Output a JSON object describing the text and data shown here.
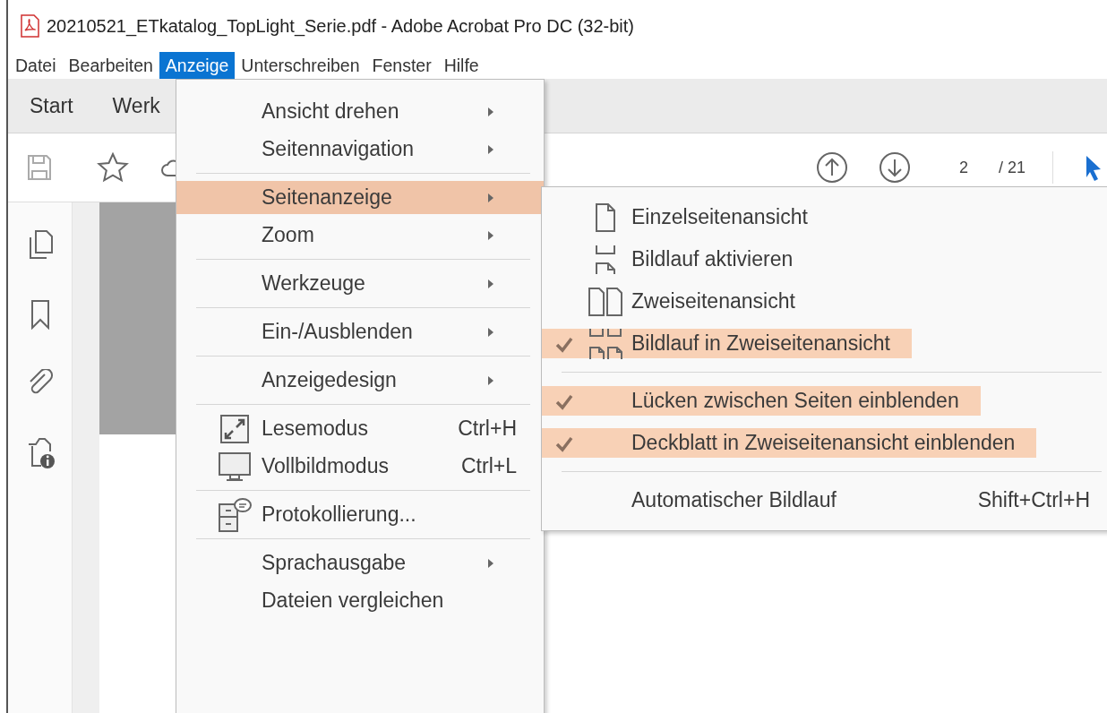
{
  "window": {
    "title": "20210521_ETkatalog_TopLight_Serie.pdf - Adobe Acrobat Pro DC (32-bit)"
  },
  "menu_bar": [
    {
      "label": "Datei",
      "selected": false
    },
    {
      "label": "Bearbeiten",
      "selected": false
    },
    {
      "label": "Anzeige",
      "selected": true
    },
    {
      "label": "Unterschreiben",
      "selected": false
    },
    {
      "label": "Fenster",
      "selected": false
    },
    {
      "label": "Hilfe",
      "selected": false
    }
  ],
  "tabs": [
    {
      "label": "Start"
    },
    {
      "label": "Werk"
    }
  ],
  "page_navigation": {
    "current_page": "2",
    "total_pages": "/ 21"
  },
  "view_menu": {
    "groups": [
      [
        {
          "label": "Ansicht drehen",
          "submenu": true,
          "selected": false
        },
        {
          "label": "Seitennavigation",
          "submenu": true,
          "selected": false
        }
      ],
      [
        {
          "label": "Seitenanzeige",
          "submenu": true,
          "selected": true
        },
        {
          "label": "Zoom",
          "submenu": true,
          "selected": false
        }
      ],
      [
        {
          "label": "Werkzeuge",
          "submenu": true,
          "selected": false
        }
      ],
      [
        {
          "label": "Ein-/Ausblenden",
          "submenu": true,
          "selected": false
        }
      ],
      [
        {
          "label": "Anzeigedesign",
          "submenu": true,
          "selected": false
        }
      ],
      [
        {
          "label": "Lesemodus",
          "shortcut": "Ctrl+H",
          "submenu": false,
          "selected": false
        },
        {
          "label": "Vollbildmodus",
          "shortcut": "Ctrl+L",
          "submenu": false,
          "selected": false
        }
      ],
      [
        {
          "label": "Protokollierung...",
          "submenu": false,
          "selected": false
        }
      ],
      [
        {
          "label": "Sprachausgabe",
          "submenu": true,
          "selected": false
        },
        {
          "label": "Dateien vergleichen",
          "submenu": false,
          "selected": false
        }
      ]
    ]
  },
  "page_display_submenu": {
    "groups": [
      [
        {
          "label": "Einzelseitenansicht",
          "checked": false,
          "highlighted": false
        },
        {
          "label": "Bildlauf aktivieren",
          "checked": false,
          "highlighted": false
        },
        {
          "label": "Zweiseitenansicht",
          "checked": false,
          "highlighted": false
        },
        {
          "label": "Bildlauf in Zweiseitenansicht",
          "checked": true,
          "highlighted": true
        }
      ],
      [
        {
          "label": "Lücken zwischen Seiten einblenden",
          "checked": true,
          "highlighted": true
        },
        {
          "label": "Deckblatt in Zweiseitenansicht einblenden",
          "checked": true,
          "highlighted": true
        }
      ],
      [
        {
          "label": "Automatischer Bildlauf",
          "shortcut": "Shift+Ctrl+H",
          "checked": false,
          "highlighted": false
        }
      ]
    ]
  }
}
